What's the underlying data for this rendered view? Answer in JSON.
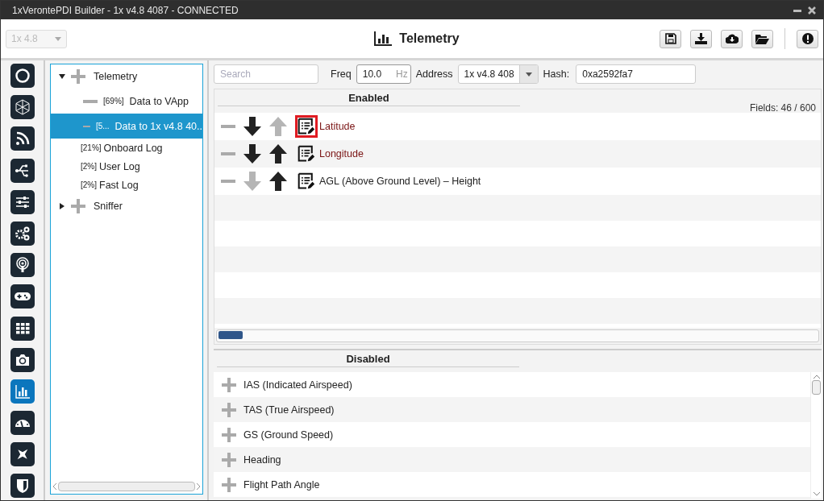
{
  "window": {
    "title": "1xVerontePDI Builder - 1x v4.8 4087 - CONNECTED"
  },
  "toolbar": {
    "device_select": {
      "value": "1x 4.8",
      "disabled": true
    },
    "title": "Telemetry"
  },
  "rail": [
    {
      "selected": false
    },
    {
      "selected": false
    },
    {
      "selected": false
    },
    {
      "selected": false
    },
    {
      "selected": false
    },
    {
      "selected": false
    },
    {
      "selected": false
    },
    {
      "selected": false
    },
    {
      "selected": false
    },
    {
      "selected": false
    },
    {
      "selected": true
    },
    {
      "selected": false
    },
    {
      "selected": false
    },
    {
      "selected": false
    }
  ],
  "tree": [
    {
      "label": "Telemetry",
      "expanded": true,
      "children": [
        {
          "kind": "channel",
          "percent": "[69%]",
          "label": "Data to VApp",
          "selected": false
        },
        {
          "kind": "channel",
          "percent": "[5...",
          "label": "Data to 1x v4.8 40..",
          "selected": true
        },
        {
          "kind": "log",
          "percent": "[21%]",
          "label": "Onboard Log",
          "selected": false
        },
        {
          "kind": "log",
          "percent": "[2%]",
          "label": "User Log",
          "selected": false
        },
        {
          "kind": "log",
          "percent": "[2%]",
          "label": "Fast Log",
          "selected": false
        }
      ]
    },
    {
      "label": "Sniffer",
      "expanded": false
    }
  ],
  "filters": {
    "search": {
      "placeholder": "Search"
    },
    "freq_label": "Freq",
    "freq": {
      "value": "10.0",
      "unit": "Hz"
    },
    "address_label": "Address",
    "address": {
      "value": "1x v4.8 408"
    },
    "hash_label": "Hash:",
    "hash": {
      "value": "0xa2592fa7"
    }
  },
  "enabled": {
    "title": "Enabled",
    "fields_count": "Fields: 46 / 600",
    "rows": [
      {
        "label": "Latitude",
        "modified": true,
        "can_move_down": true,
        "can_move_up": false,
        "highlighted": true
      },
      {
        "label": "Longitude",
        "modified": true,
        "can_move_down": true,
        "can_move_up": true,
        "highlighted": false
      },
      {
        "label": "AGL (Above Ground Level) – Height",
        "modified": false,
        "can_move_down": false,
        "can_move_up": true,
        "highlighted": false
      }
    ]
  },
  "disabled": {
    "title": "Disabled",
    "rows": [
      {
        "label": "IAS (Indicated Airspeed)"
      },
      {
        "label": "TAS (True Airspeed)"
      },
      {
        "label": "GS (Ground Speed)"
      },
      {
        "label": "Heading"
      },
      {
        "label": "Flight Path Angle"
      }
    ]
  }
}
